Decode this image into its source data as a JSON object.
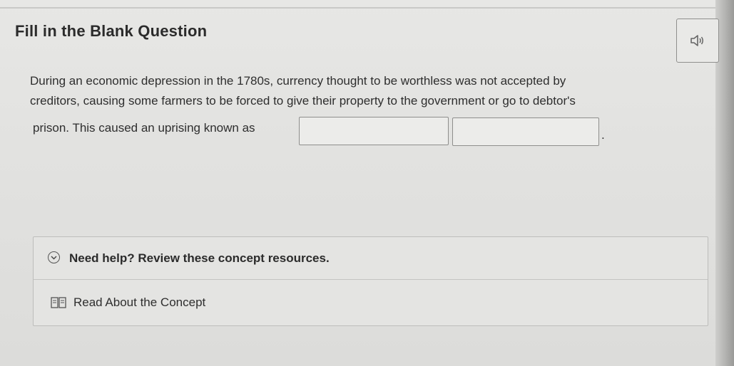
{
  "question": {
    "heading": "Fill in the Blank Question",
    "line1": "During an economic depression in the 1780s, currency thought to be worthless was not accepted by",
    "line2": "creditors, causing some farmers to be forced to give their property to the government or go to debtor's",
    "line3": "prison. This caused an uprising known as",
    "after_blanks": ".",
    "blanks": [
      {
        "value": "",
        "placeholder": ""
      },
      {
        "value": "",
        "placeholder": ""
      }
    ]
  },
  "audio": {
    "icon": "speaker-icon"
  },
  "help": {
    "toggle_label": "Need help? Review these concept resources.",
    "toggle_icon": "chevron-down-icon",
    "resources": [
      {
        "label": "Read About the Concept",
        "icon": "book-icon"
      }
    ]
  },
  "colors": {
    "text": "#2e2e2e",
    "border": "#8e8e8c",
    "panel_bg": "#e4e4e2"
  }
}
